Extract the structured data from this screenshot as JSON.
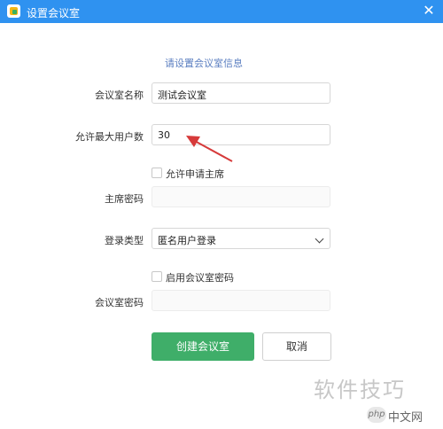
{
  "window": {
    "title": "设置会议室",
    "close_glyph": "✕"
  },
  "form": {
    "section_title": "请设置会议室信息",
    "room_name": {
      "label": "会议室名称",
      "value": "测试会议室"
    },
    "max_users": {
      "label": "允许最大用户数",
      "value": "30"
    },
    "allow_apply_host": {
      "label": "允许申请主席",
      "checked": false
    },
    "host_password": {
      "label": "主席密码",
      "value": ""
    },
    "login_type": {
      "label": "登录类型",
      "value": "匿名用户登录"
    },
    "enable_room_password": {
      "label": "启用会议室密码",
      "checked": false
    },
    "room_password": {
      "label": "会议室密码",
      "value": ""
    }
  },
  "buttons": {
    "create": "创建会议室",
    "cancel": "取消"
  },
  "watermark": {
    "text": "软件技巧",
    "logo": "php",
    "site": "中文网"
  },
  "colors": {
    "titlebar": "#2f92f0",
    "primary": "#3fae69",
    "annotation": "#d63a3a"
  }
}
